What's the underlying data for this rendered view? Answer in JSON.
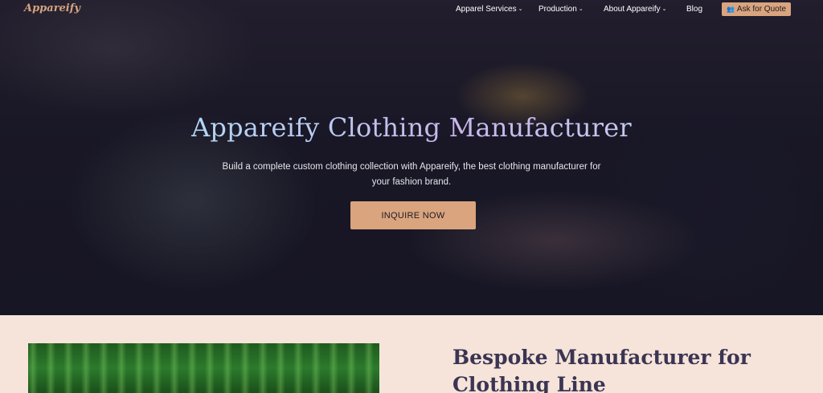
{
  "brand": {
    "logo": "Appareify"
  },
  "nav": {
    "items": [
      {
        "label": "Apparel Services",
        "has_dropdown": true
      },
      {
        "label": "Production",
        "has_dropdown": true
      },
      {
        "label": "About Appareify",
        "has_dropdown": true
      },
      {
        "label": "Blog",
        "has_dropdown": false
      }
    ],
    "quote_button": {
      "label": "Ask for Quote",
      "icon": "users-icon"
    }
  },
  "hero": {
    "title": "Appareify Clothing Manufacturer",
    "subtitle": "Build a complete custom clothing collection with Appareify, the best clothing manufacturer for your fashion brand.",
    "cta_label": "INQUIRE NOW"
  },
  "section2": {
    "title": "Bespoke Manufacturer for Clothing Line"
  },
  "colors": {
    "accent": "#d9a47e",
    "section_bg": "#f6e4da",
    "heading": "#3b3553"
  }
}
